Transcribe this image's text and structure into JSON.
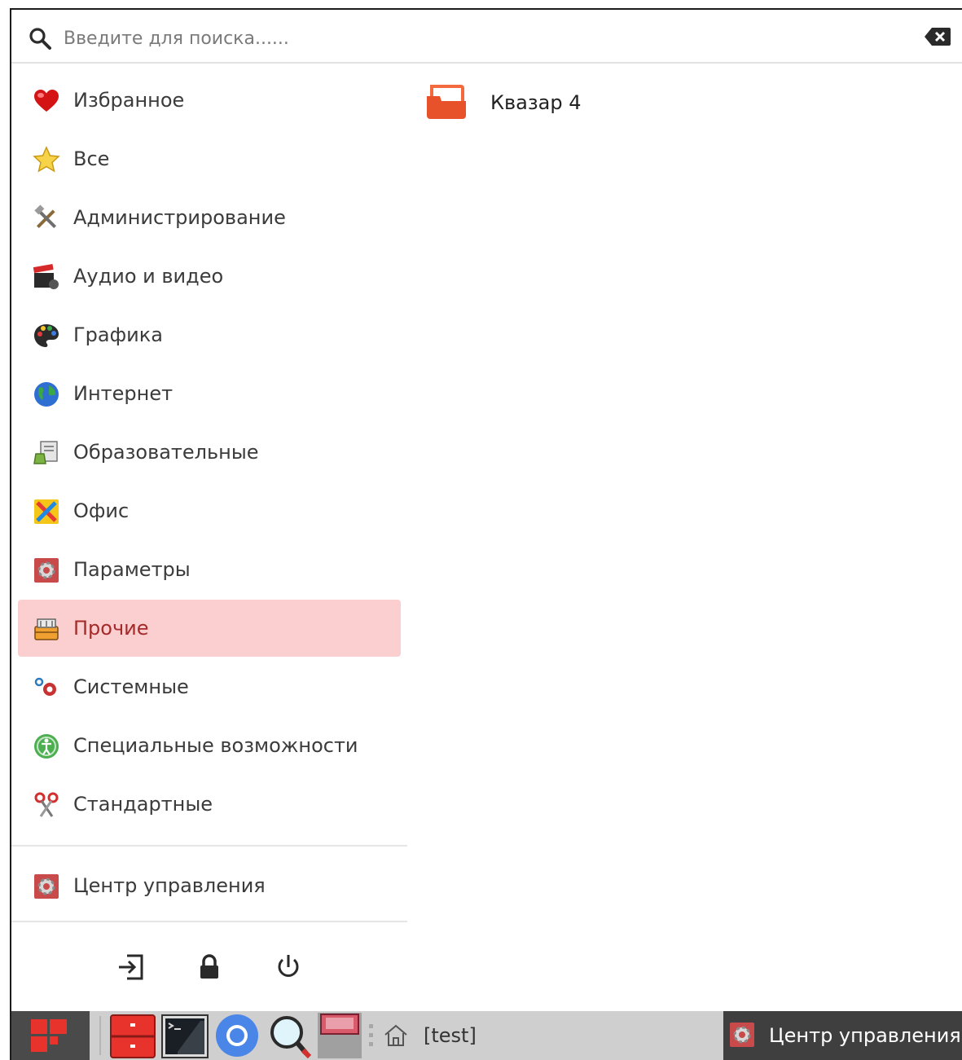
{
  "search": {
    "placeholder": "Введите для поиска......",
    "value": ""
  },
  "categories": [
    {
      "label": "Избранное",
      "icon": "heart-icon"
    },
    {
      "label": "Все",
      "icon": "star-icon"
    },
    {
      "label": "Администрирование",
      "icon": "tools-icon"
    },
    {
      "label": "Аудио и видео",
      "icon": "clapperboard-icon"
    },
    {
      "label": "Графика",
      "icon": "palette-icon"
    },
    {
      "label": "Интернет",
      "icon": "globe-icon"
    },
    {
      "label": "Образовательные",
      "icon": "education-icon"
    },
    {
      "label": "Офис",
      "icon": "office-icon"
    },
    {
      "label": "Параметры",
      "icon": "settings-icon"
    },
    {
      "label": "Прочие",
      "icon": "toolbox-icon",
      "selected": true
    },
    {
      "label": "Системные",
      "icon": "system-gears-icon"
    },
    {
      "label": "Специальные возможности",
      "icon": "accessibility-icon"
    },
    {
      "label": "Стандартные",
      "icon": "scissors-icon"
    }
  ],
  "control_center": {
    "label": "Центр управления",
    "icon": "control-center-icon"
  },
  "session_actions": [
    "logout-icon",
    "lock-icon",
    "power-icon"
  ],
  "apps": [
    {
      "label": "Квазар 4",
      "icon": "folder-app-icon"
    }
  ],
  "taskbar": {
    "launchers": [
      "file-manager-icon",
      "terminal-icon",
      "chromium-icon",
      "search-tool-icon",
      "window-app-icon"
    ],
    "workspace_label": "[test]",
    "active_task": {
      "label": "Центр управления",
      "icon": "control-center-icon"
    }
  },
  "colors": {
    "selected_bg": "#fbcfd0",
    "selected_text": "#a52a2a",
    "accent": "#e8322c",
    "taskbar": "#cfcfcf"
  }
}
